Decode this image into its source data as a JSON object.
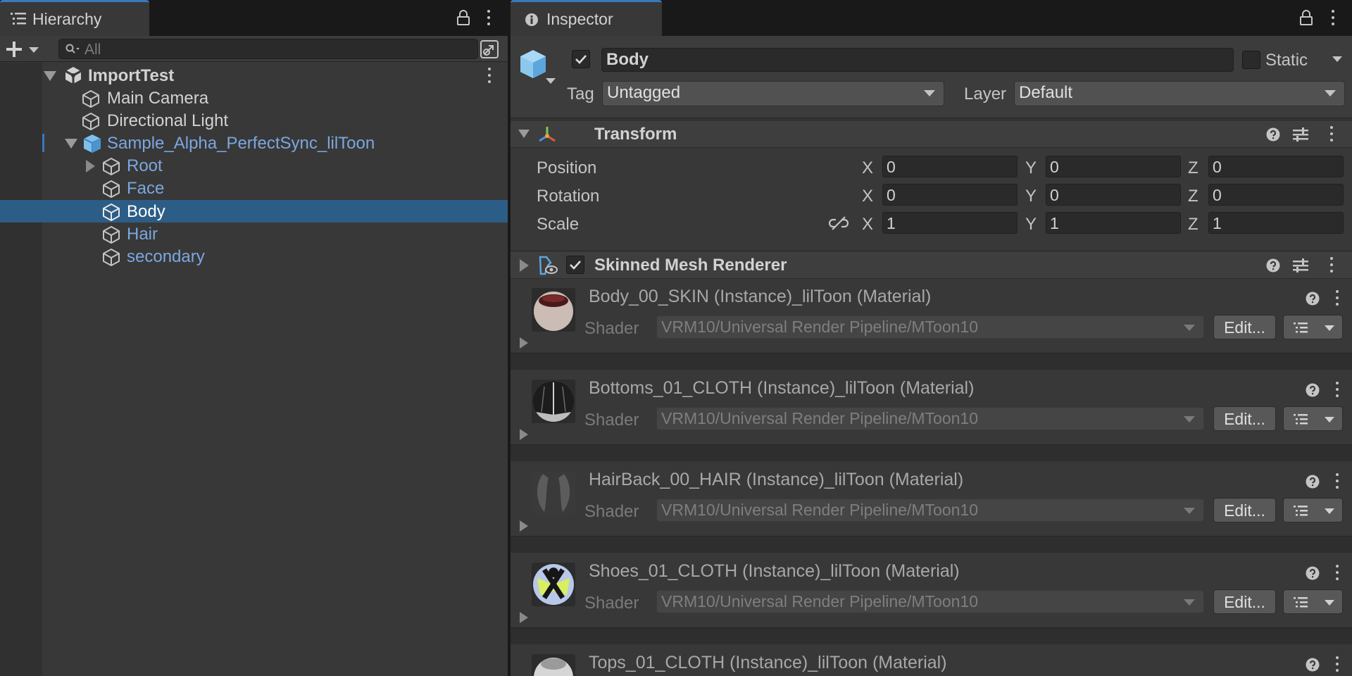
{
  "hierarchy": {
    "tab_label": "Hierarchy",
    "search_placeholder": "All",
    "items": [
      {
        "label": "ImportTest",
        "icon": "unity-scene-icon"
      },
      {
        "label": "Main Camera",
        "icon": "gameobject-icon"
      },
      {
        "label": "Directional Light",
        "icon": "gameobject-icon"
      },
      {
        "label": "Sample_Alpha_PerfectSync_lilToon",
        "icon": "prefab-icon"
      },
      {
        "label": "Root",
        "icon": "gameobject-icon"
      },
      {
        "label": "Face",
        "icon": "gameobject-icon"
      },
      {
        "label": "Body",
        "icon": "gameobject-icon",
        "selected": true
      },
      {
        "label": "Hair",
        "icon": "gameobject-icon"
      },
      {
        "label": "secondary",
        "icon": "gameobject-icon"
      }
    ]
  },
  "inspector": {
    "tab_label": "Inspector",
    "object_name": "Body",
    "active": true,
    "static_label": "Static",
    "tag_label": "Tag",
    "tag_value": "Untagged",
    "layer_label": "Layer",
    "layer_value": "Default",
    "transform": {
      "title": "Transform",
      "rows": [
        {
          "label": "Position",
          "x": "0",
          "y": "0",
          "z": "0"
        },
        {
          "label": "Rotation",
          "x": "0",
          "y": "0",
          "z": "0"
        },
        {
          "label": "Scale",
          "x": "1",
          "y": "1",
          "z": "1"
        }
      ],
      "axis_x": "X",
      "axis_y": "Y",
      "axis_z": "Z"
    },
    "renderer": {
      "title": "Skinned Mesh Renderer",
      "enabled": true
    },
    "shader_label": "Shader",
    "edit_label": "Edit...",
    "materials": [
      {
        "name": "Body_00_SKIN (Instance)_lilToon (Material)",
        "shader": "VRM10/Universal Render Pipeline/MToon10"
      },
      {
        "name": "Bottoms_01_CLOTH (Instance)_lilToon (Material)",
        "shader": "VRM10/Universal Render Pipeline/MToon10"
      },
      {
        "name": "HairBack_00_HAIR (Instance)_lilToon (Material)",
        "shader": "VRM10/Universal Render Pipeline/MToon10"
      },
      {
        "name": "Shoes_01_CLOTH (Instance)_lilToon (Material)",
        "shader": "VRM10/Universal Render Pipeline/MToon10"
      },
      {
        "name": "Tops_01_CLOTH (Instance)_lilToon (Material)",
        "shader": ""
      }
    ]
  },
  "colors": {
    "selection": "#2c5d87",
    "accent": "#3a79bb",
    "prefab_text": "#7ba7e0"
  }
}
